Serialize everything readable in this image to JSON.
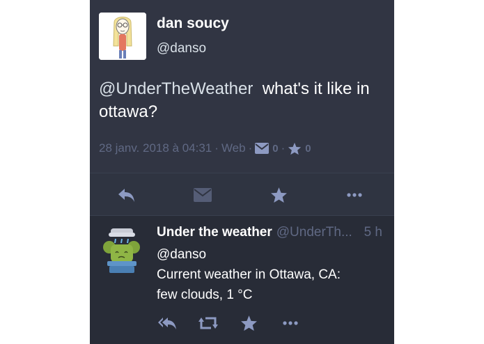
{
  "detailed_status": {
    "author": {
      "display_name": "dan soucy",
      "handle": "@danso"
    },
    "content": {
      "mention": "@UnderTheWeather",
      "text": "  what's it like in ottawa?"
    },
    "meta": {
      "timestamp": "28 janv. 2018 à 04:31",
      "separator": "·",
      "application": "Web",
      "reblogs_count": "0",
      "favourites_count": "0"
    },
    "actions": [
      "reply-icon",
      "envelope-icon",
      "star-icon",
      "ellipsis-icon"
    ]
  },
  "reply_status": {
    "author": {
      "display_name": "Under the weather",
      "handle": "@UnderTh...",
      "relative_time": "5 h"
    },
    "content": {
      "mention": "@danso",
      "line1": "Current weather in Ottawa, CA:",
      "line2": "few clouds, 1 °C"
    },
    "actions": [
      "reply-all-icon",
      "boost-icon",
      "star-icon",
      "ellipsis-icon"
    ]
  },
  "colors": {
    "background": "#282c37",
    "detailed_background": "#313543",
    "text_primary": "#ffffff",
    "text_secondary": "#d9e1e8",
    "text_muted": "#606984",
    "icon_muted": "#8d9ac2"
  }
}
